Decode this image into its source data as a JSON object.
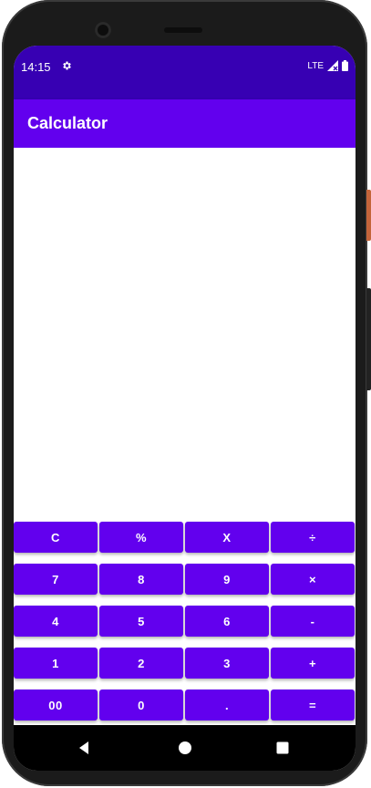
{
  "status_bar": {
    "time": "14:15",
    "network": "LTE",
    "icons": [
      "settings-gear-icon",
      "signal-icon",
      "battery-icon"
    ]
  },
  "app_bar": {
    "title": "Calculator"
  },
  "display": {
    "expression": "",
    "result": ""
  },
  "keypad": {
    "rows": [
      [
        "C",
        "%",
        "X",
        "÷"
      ],
      [
        "7",
        "8",
        "9",
        "×"
      ],
      [
        "4",
        "5",
        "6",
        "-"
      ],
      [
        "1",
        "2",
        "3",
        "+"
      ],
      [
        "00",
        "0",
        ".",
        "="
      ]
    ]
  },
  "nav_bar": {
    "icons": [
      "back-icon",
      "home-icon",
      "recents-icon"
    ]
  },
  "colors": {
    "primary": "#6200ee",
    "primary_dark": "#3700b3",
    "button_text": "#ffffff",
    "background": "#ffffff"
  }
}
